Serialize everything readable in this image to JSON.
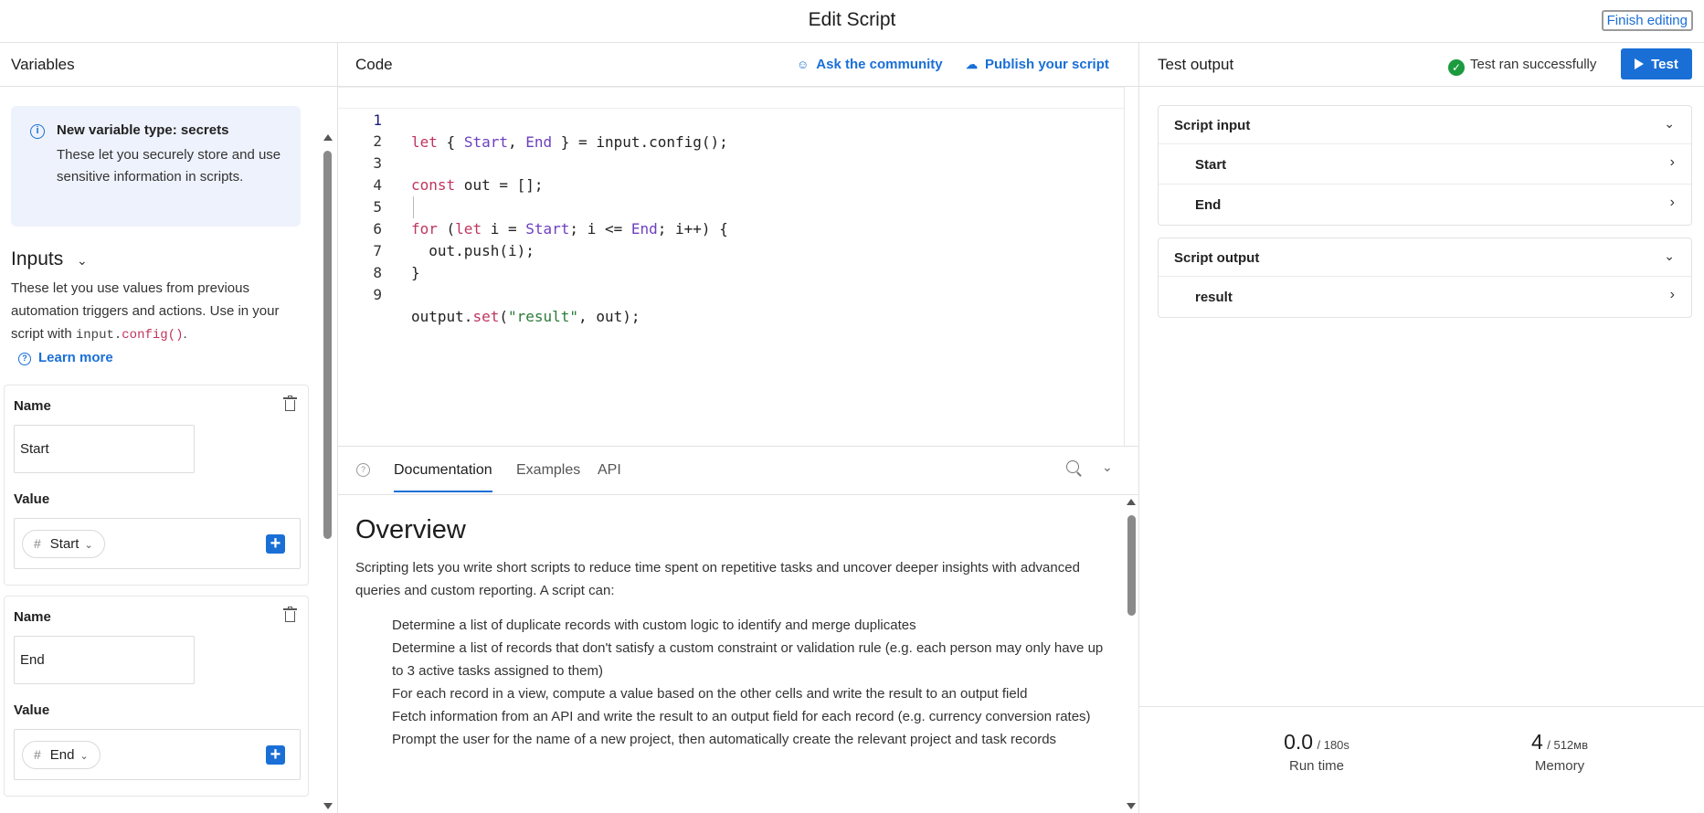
{
  "header": {
    "title": "Edit Script",
    "finish_label": "Finish editing"
  },
  "variables_panel": {
    "title": "Variables",
    "info": {
      "title": "New variable type: secrets",
      "text": "These let you securely store and use sensitive information in scripts."
    },
    "inputs_heading": "Inputs",
    "inputs_desc_before": "These let you use values from previous automation triggers and actions. Use in your script with",
    "code_obj": "input.",
    "code_fn": "config()",
    "inputs_desc_after": ".",
    "learn_more": "Learn more",
    "name_label": "Name",
    "value_label": "Value",
    "cards": [
      {
        "name": "Start",
        "token": "Start"
      },
      {
        "name": "End",
        "token": "End"
      }
    ]
  },
  "code_panel": {
    "title": "Code",
    "ask_community": "Ask the community",
    "publish": "Publish your script",
    "line_numbers": [
      "1",
      "2",
      "3",
      "4",
      "5",
      "6",
      "7",
      "8",
      "9"
    ]
  },
  "docs": {
    "tabs": [
      "Documentation",
      "Examples",
      "API"
    ],
    "heading": "Overview",
    "intro": "Scripting lets you write short scripts to reduce time spent on repetitive tasks and uncover deeper insights with advanced queries and custom reporting. A script can:",
    "items": [
      "Determine a list of duplicate records with custom logic to identify and merge duplicates",
      "Determine a list of records that don't satisfy a custom constraint or validation rule (e.g. each person may only have up to 3 active tasks assigned to them)",
      "For each record in a view, compute a value based on the other cells and write the result to an output field",
      "Fetch information from an API and write the result to an output field for each record (e.g. currency conversion rates)",
      "Prompt the user for the name of a new project, then automatically create the relevant project and task records"
    ]
  },
  "test_panel": {
    "title": "Test output",
    "status": "Test ran successfully",
    "test_label": "Test",
    "script_input": {
      "title": "Script input",
      "rows": [
        "Start",
        "End"
      ]
    },
    "script_output": {
      "title": "Script output",
      "rows": [
        "result"
      ]
    },
    "stats": {
      "run_time": {
        "value": "0.0",
        "limit": "/ 180s",
        "label": "Run time"
      },
      "memory": {
        "value": "4",
        "limit": "/ 512мв",
        "label": "Memory"
      }
    }
  },
  "colors": {
    "accent": "#1a6fd6",
    "success": "#1b9a3e",
    "keyword": "#c0355f",
    "variable": "#6c3fbf",
    "string": "#2a7a3a"
  }
}
